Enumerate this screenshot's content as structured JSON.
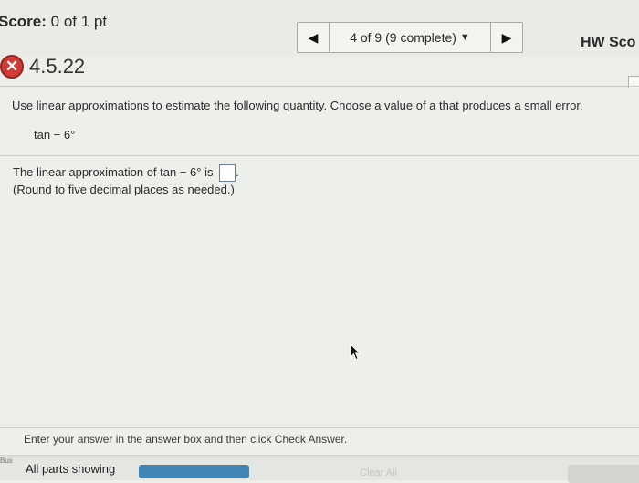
{
  "header": {
    "score_label": "Score:",
    "score_value": "0 of 1 pt",
    "nav": {
      "progress_text": "4 of 9 (9 complete)",
      "prev_icon": "triangle-left-icon",
      "next_icon": "triangle-right-icon",
      "dropdown_icon": "caret-down-icon"
    },
    "hw_score_label": "HW Sco"
  },
  "question": {
    "status_icon": "x-icon",
    "id": "4.5.22",
    "prompt": "Use linear approximations to estimate the following quantity. Choose a value of a that produces a small error.",
    "expression": "tan − 6°",
    "answer_line_prefix": "The linear approximation of ",
    "answer_line_expr": "tan − 6°",
    "answer_line_mid": " is ",
    "answer_value": "",
    "answer_line_suffix": ".",
    "rounding_note": "(Round to five decimal places as needed.)"
  },
  "footer": {
    "instruction": "Enter your answer in the answer box and then click Check Answer.",
    "side_label": "Bus",
    "parts_label": "All parts showing",
    "clear_all_label": "Clear All"
  },
  "colors": {
    "accent": "#3f86b7",
    "error": "#d23b35"
  }
}
